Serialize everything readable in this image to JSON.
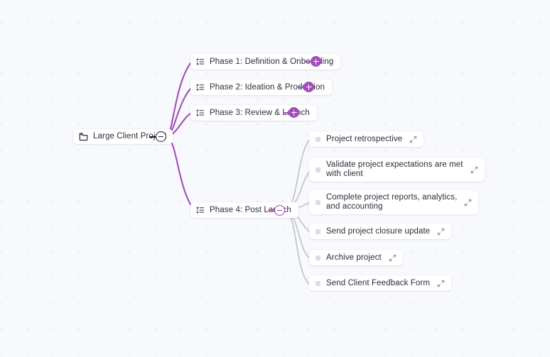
{
  "canvas": {
    "background_color": "#f8f9fc",
    "dot_color": "#eceef4",
    "accent_color": "#a44cb9",
    "link_color_primary": "#9b3fb5",
    "link_color_secondary": "#c3c4ca",
    "text_color": "#2b2b38"
  },
  "root": {
    "label": "Large Client Project",
    "icon": "folder-icon",
    "toggle": {
      "icon": "minus-icon",
      "state": "expanded"
    }
  },
  "phases": [
    {
      "label": "Phase 1: Definition & Onboarding",
      "icon": "list-icon",
      "action": {
        "icon": "plus-icon",
        "state": "collapsed"
      }
    },
    {
      "label": "Phase 2: Ideation & Production",
      "icon": "list-icon",
      "action": {
        "icon": "plus-icon",
        "state": "collapsed"
      }
    },
    {
      "label": "Phase 3: Review & Launch",
      "icon": "list-icon",
      "action": {
        "icon": "plus-icon",
        "state": "collapsed"
      }
    },
    {
      "label": "Phase 4: Post Launch",
      "icon": "list-icon",
      "action": {
        "icon": "minus-icon",
        "state": "expanded"
      }
    }
  ],
  "tasks": [
    {
      "label": "Project retrospective",
      "icon": "square-icon",
      "expand_icon": "expand-diagonal-icon"
    },
    {
      "label": "Validate project expectations are met\nwith client",
      "icon": "square-icon",
      "expand_icon": "expand-diagonal-icon"
    },
    {
      "label": "Complete project reports, analytics,\nand accounting",
      "icon": "square-icon",
      "expand_icon": "expand-diagonal-icon"
    },
    {
      "label": "Send project closure update",
      "icon": "square-icon",
      "expand_icon": "expand-diagonal-icon"
    },
    {
      "label": "Archive project",
      "icon": "square-icon",
      "expand_icon": "expand-diagonal-icon"
    },
    {
      "label": "Send Client Feedback Form",
      "icon": "square-icon",
      "expand_icon": "expand-diagonal-icon"
    }
  ]
}
